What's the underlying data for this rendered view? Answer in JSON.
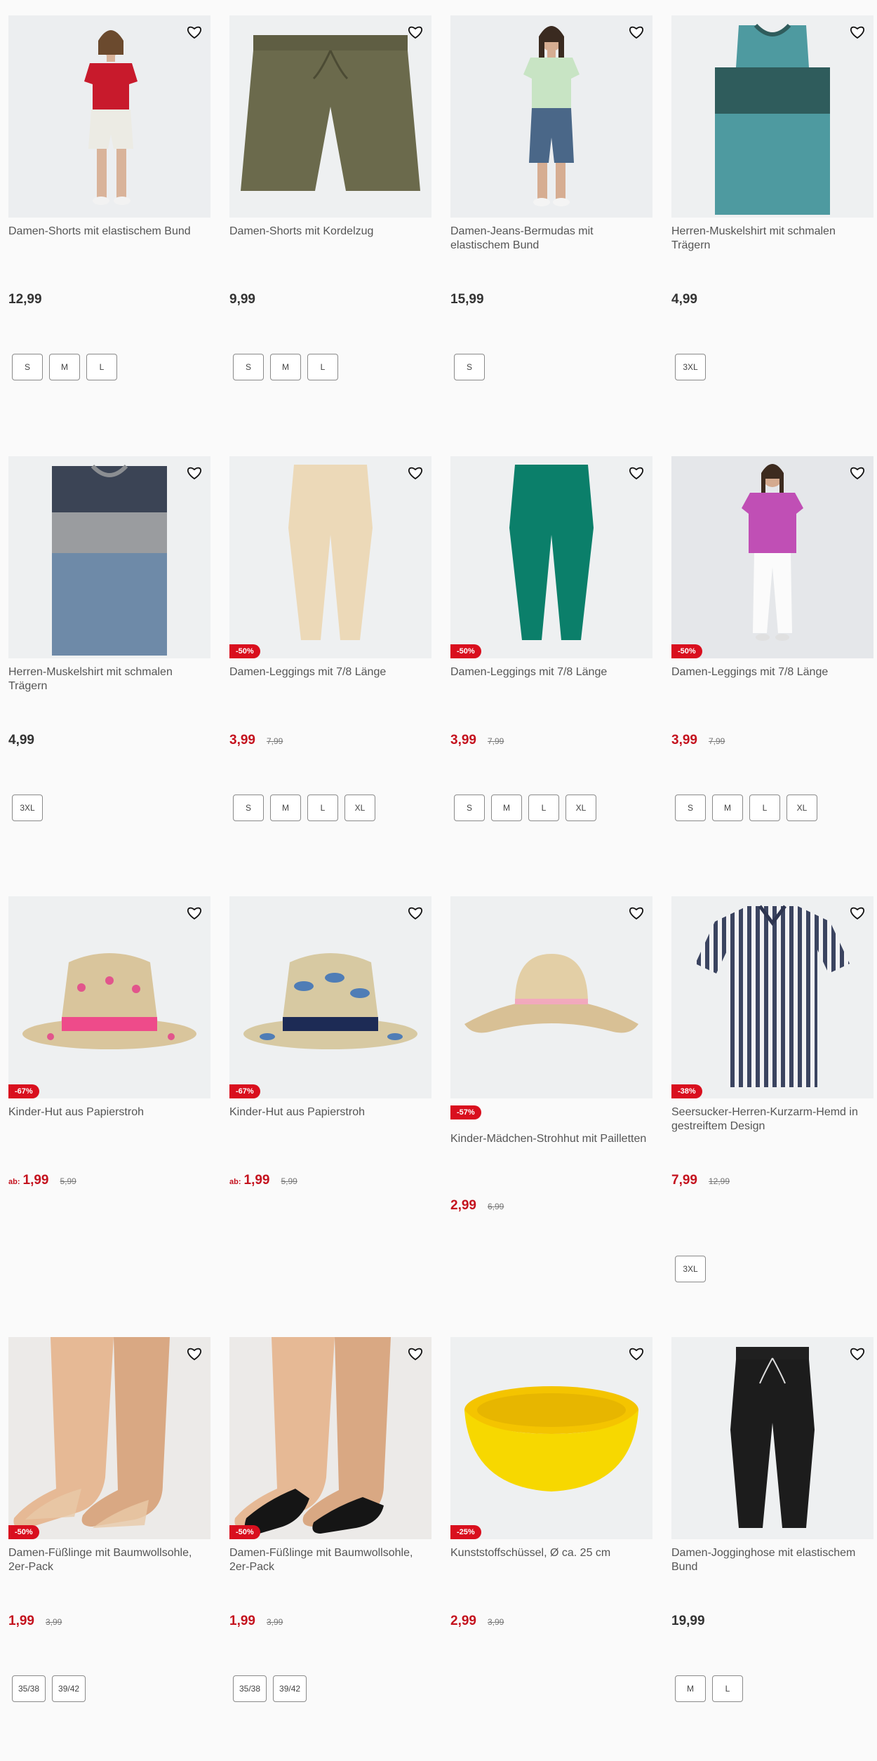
{
  "products": [
    {
      "title": "Damen-Shorts mit elastischem Bund",
      "price": "12,99",
      "sizes": [
        "S",
        "M",
        "L"
      ],
      "image": "woman-red-top-white-shorts"
    },
    {
      "title": "Damen-Shorts mit Kordelzug",
      "price": "9,99",
      "sizes": [
        "S",
        "M",
        "L"
      ],
      "image": "olive-shorts"
    },
    {
      "title": "Damen-Jeans-Bermudas mit elastischem Bund",
      "price": "15,99",
      "sizes": [
        "S"
      ],
      "image": "woman-mint-top-jeans-bermudas"
    },
    {
      "title": "Herren-Muskelshirt mit schmalen Trägern",
      "price": "4,99",
      "sizes": [
        "3XL"
      ],
      "image": "teal-tank-top"
    },
    {
      "title": "Herren-Muskelshirt mit schmalen Trägern",
      "price": "4,99",
      "sizes": [
        "3XL"
      ],
      "image": "blue-grey-tank-top"
    },
    {
      "title": "Damen-Leggings mit 7/8 Länge",
      "price": "3,99",
      "old_price": "7,99",
      "badge": "-50%",
      "sizes": [
        "S",
        "M",
        "L",
        "XL"
      ],
      "image": "beige-leggings"
    },
    {
      "title": "Damen-Leggings mit 7/8 Länge",
      "price": "3,99",
      "old_price": "7,99",
      "badge": "-50%",
      "sizes": [
        "S",
        "M",
        "L",
        "XL"
      ],
      "image": "green-leggings"
    },
    {
      "title": "Damen-Leggings mit 7/8 Länge",
      "price": "3,99",
      "old_price": "7,99",
      "badge": "-50%",
      "sizes": [
        "S",
        "M",
        "L",
        "XL"
      ],
      "image": "woman-pink-top-white-leggings"
    },
    {
      "title": "Kinder-Hut aus Papierstroh",
      "price": "1,99",
      "prefix": "ab:",
      "old_price": "5,99",
      "badge": "-67%",
      "sizes": [],
      "image": "flamingo-straw-hat"
    },
    {
      "title": "Kinder-Hut aus Papierstroh",
      "price": "1,99",
      "prefix": "ab:",
      "old_price": "5,99",
      "badge": "-67%",
      "sizes": [],
      "image": "shark-straw-hat"
    },
    {
      "title": "Kinder-Mädchen-Strohhut mit Pailletten",
      "price": "2,99",
      "old_price": "6,99",
      "badge": "-57%",
      "badge_inline": true,
      "sizes": [],
      "image": "straw-sun-hat"
    },
    {
      "title": "Seersucker-Herren-Kurzarm-Hemd in gestreiftem Design",
      "price": "7,99",
      "old_price": "12,99",
      "badge": "-38%",
      "sizes": [
        "3XL"
      ],
      "image": "striped-shirt"
    },
    {
      "title": "Damen-Füßlinge mit Baumwollsohle, 2er-Pack",
      "price": "1,99",
      "old_price": "3,99",
      "badge": "-50%",
      "sizes": [
        "35/38",
        "39/42"
      ],
      "image": "nude-footies"
    },
    {
      "title": "Damen-Füßlinge mit Baumwollsohle, 2er-Pack",
      "price": "1,99",
      "old_price": "3,99",
      "badge": "-50%",
      "sizes": [
        "35/38",
        "39/42"
      ],
      "image": "black-footies"
    },
    {
      "title": "Kunststoffschüssel, Ø ca. 25 cm",
      "price": "2,99",
      "old_price": "3,99",
      "badge": "-25%",
      "sizes": [],
      "image": "yellow-bowl"
    },
    {
      "title": "Damen-Jogginghose mit elastischem Bund",
      "price": "19,99",
      "sizes": [
        "M",
        "L"
      ],
      "image": "black-joggers"
    }
  ],
  "colors": {
    "sale": "#c4121e",
    "badge": "#d90f1e",
    "text": "#333333",
    "image_bg": "#eef0f1"
  }
}
